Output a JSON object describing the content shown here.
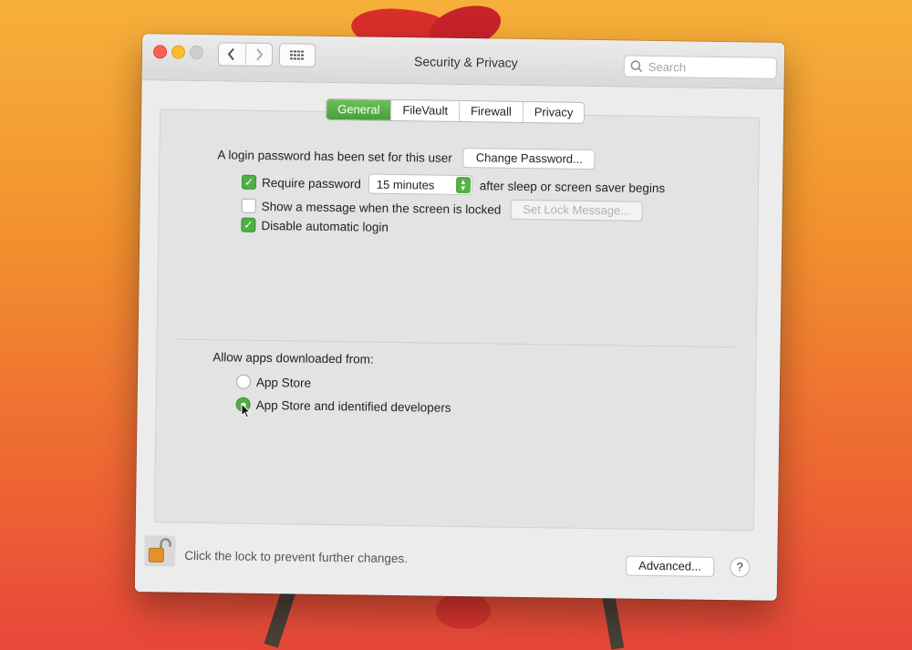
{
  "window": {
    "title": "Security & Privacy",
    "search_placeholder": "Search"
  },
  "tabs": [
    "General",
    "FileVault",
    "Firewall",
    "Privacy"
  ],
  "active_tab": "General",
  "general": {
    "login_password_text": "A login password has been set for this user",
    "change_password_button": "Change Password...",
    "require_password_label": "Require password",
    "require_password_checked": true,
    "require_password_interval": "15 minutes",
    "after_sleep_text": "after sleep or screen saver begins",
    "show_message_label": "Show a message when the screen is locked",
    "show_message_checked": false,
    "set_lock_message_button": "Set Lock Message...",
    "disable_auto_login_label": "Disable automatic login",
    "disable_auto_login_checked": true,
    "allow_apps_label": "Allow apps downloaded from:",
    "radio_app_store": "App Store",
    "radio_identified": "App Store and identified developers",
    "selected_radio": "App Store and identified developers"
  },
  "footer": {
    "lock_text": "Click the lock to prevent further changes.",
    "advanced_button": "Advanced...",
    "help_button": "?"
  },
  "colors": {
    "accent_green": "#4fb042",
    "window_bg": "#ececec"
  }
}
